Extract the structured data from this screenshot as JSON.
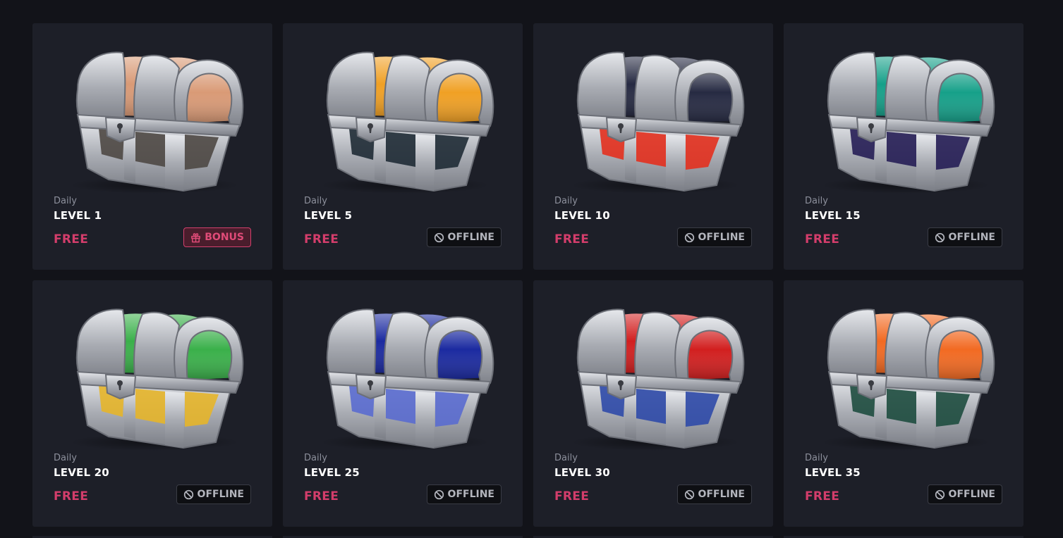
{
  "colors": {
    "background": "#121319",
    "card": "#1d1f28",
    "price": "#d33d6b",
    "bonus": "#e04b78"
  },
  "cases": [
    {
      "subtitle": "Daily",
      "title": "LEVEL 1",
      "price": "FREE",
      "status": "BONUS",
      "status_icon": "gift-icon",
      "lid": "#d99a76",
      "base": "#4e4844"
    },
    {
      "subtitle": "Daily",
      "title": "LEVEL 5",
      "price": "FREE",
      "status": "OFFLINE",
      "status_icon": "ban-icon",
      "lid": "#f0a024",
      "base": "#1f2b35"
    },
    {
      "subtitle": "Daily",
      "title": "LEVEL 10",
      "price": "FREE",
      "status": "OFFLINE",
      "status_icon": "ban-icon",
      "lid": "#262a42",
      "base": "#e3301e"
    },
    {
      "subtitle": "Daily",
      "title": "LEVEL 15",
      "price": "FREE",
      "status": "OFFLINE",
      "status_icon": "ban-icon",
      "lid": "#16a089",
      "base": "#261e55"
    },
    {
      "subtitle": "Daily",
      "title": "LEVEL 20",
      "price": "FREE",
      "status": "OFFLINE",
      "status_icon": "ban-icon",
      "lid": "#3ab04a",
      "base": "#e6b52a"
    },
    {
      "subtitle": "Daily",
      "title": "LEVEL 25",
      "price": "FREE",
      "status": "OFFLINE",
      "status_icon": "ban-icon",
      "lid": "#1b2aa0",
      "base": "#5a6ccf"
    },
    {
      "subtitle": "Daily",
      "title": "LEVEL 30",
      "price": "FREE",
      "status": "OFFLINE",
      "status_icon": "ban-icon",
      "lid": "#d21f1f",
      "base": "#2f4aa8"
    },
    {
      "subtitle": "Daily",
      "title": "LEVEL 35",
      "price": "FREE",
      "status": "OFFLINE",
      "status_icon": "ban-icon",
      "lid": "#f26a22",
      "base": "#1e4d3f"
    }
  ]
}
